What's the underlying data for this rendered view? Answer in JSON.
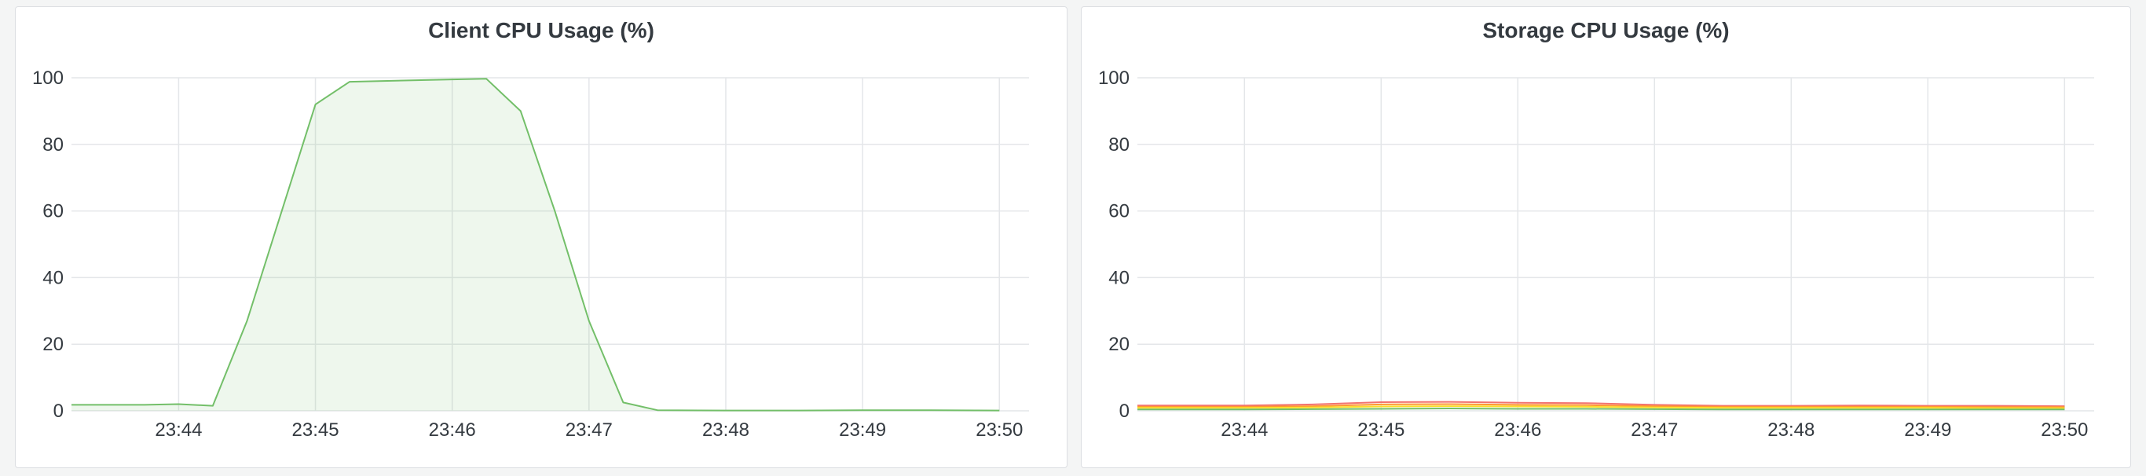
{
  "chart_data": [
    {
      "type": "area",
      "title": "Client CPU Usage (%)",
      "ylim": [
        0,
        100
      ],
      "yticks": [
        0,
        20,
        40,
        60,
        80,
        100
      ],
      "xlim": [
        "23:43:13",
        "23:50:13"
      ],
      "xticks": [
        "23:44",
        "23:45",
        "23:46",
        "23:47",
        "23:48",
        "23:49",
        "23:50"
      ],
      "grid": true,
      "series": [
        {
          "color": "#73bf69",
          "x": [
            "23:43:13",
            "23:43:45",
            "23:44:00",
            "23:44:15",
            "23:44:30",
            "23:45:00",
            "23:45:15",
            "23:46:00",
            "23:46:15",
            "23:46:30",
            "23:46:45",
            "23:47:00",
            "23:47:15",
            "23:47:30",
            "23:48:00",
            "23:48:30",
            "23:49:00",
            "23:49:30",
            "23:50:00"
          ],
          "values": [
            1.8,
            1.8,
            2.0,
            1.5,
            27,
            92,
            98.8,
            99.5,
            99.7,
            90,
            60,
            27,
            2.5,
            0.2,
            0.1,
            0.1,
            0.2,
            0.2,
            0.1
          ]
        }
      ]
    },
    {
      "type": "line",
      "title": "Storage CPU Usage (%)",
      "ylim": [
        0,
        100
      ],
      "yticks": [
        0,
        20,
        40,
        60,
        80,
        100
      ],
      "xlim": [
        "23:43:13",
        "23:50:13"
      ],
      "xticks": [
        "23:44",
        "23:45",
        "23:46",
        "23:47",
        "23:48",
        "23:49",
        "23:50"
      ],
      "grid": true,
      "series": [
        {
          "color": "#f2726f",
          "x": [
            "23:43:13",
            "23:44:00",
            "23:44:30",
            "23:45:00",
            "23:45:30",
            "23:46:00",
            "23:46:30",
            "23:47:00",
            "23:47:30",
            "23:48:00",
            "23:48:30",
            "23:49:00",
            "23:49:30",
            "23:50:00"
          ],
          "values": [
            1.6,
            1.6,
            1.9,
            2.6,
            2.7,
            2.4,
            2.3,
            1.8,
            1.5,
            1.5,
            1.6,
            1.5,
            1.5,
            1.4
          ]
        },
        {
          "color": "#ff9830",
          "x": [
            "23:43:13",
            "23:44:00",
            "23:44:30",
            "23:45:00",
            "23:45:30",
            "23:46:00",
            "23:46:30",
            "23:47:00",
            "23:47:30",
            "23:48:00",
            "23:48:30",
            "23:49:00",
            "23:49:30",
            "23:50:00"
          ],
          "values": [
            1.2,
            1.2,
            1.4,
            1.9,
            2.0,
            1.8,
            1.7,
            1.4,
            1.2,
            1.2,
            1.2,
            1.2,
            1.1,
            1.1
          ]
        },
        {
          "color": "#fade2a",
          "x": [
            "23:43:13",
            "23:44:00",
            "23:44:30",
            "23:45:00",
            "23:45:30",
            "23:46:00",
            "23:46:30",
            "23:47:00",
            "23:47:30",
            "23:48:00",
            "23:48:30",
            "23:49:00",
            "23:49:30",
            "23:50:00"
          ],
          "values": [
            0.9,
            0.9,
            1.0,
            1.3,
            1.4,
            1.3,
            1.2,
            1.0,
            0.9,
            0.9,
            0.9,
            0.9,
            0.8,
            0.8
          ]
        },
        {
          "color": "#73bf69",
          "x": [
            "23:43:13",
            "23:44:00",
            "23:44:30",
            "23:45:00",
            "23:45:30",
            "23:46:00",
            "23:46:30",
            "23:47:00",
            "23:47:30",
            "23:48:00",
            "23:48:30",
            "23:49:00",
            "23:49:30",
            "23:50:00"
          ],
          "values": [
            0.4,
            0.4,
            0.5,
            0.6,
            0.7,
            0.6,
            0.6,
            0.5,
            0.4,
            0.4,
            0.4,
            0.4,
            0.4,
            0.4
          ]
        }
      ]
    }
  ]
}
